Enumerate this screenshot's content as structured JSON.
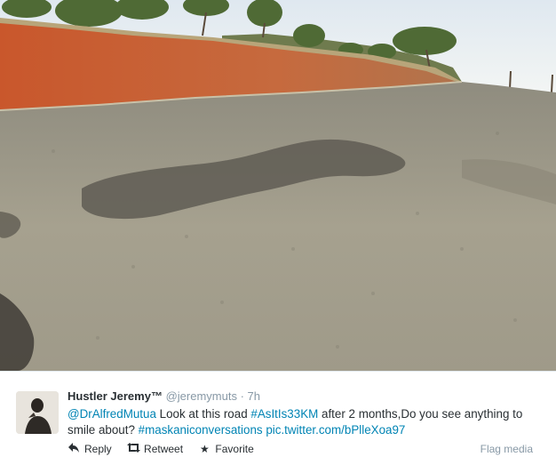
{
  "tweet": {
    "fullname": "Hustler Jeremy™",
    "username": "@jeremymuts",
    "separator": "·",
    "time": "7h",
    "text_segments": [
      {
        "text": "@DrAlfredMutua",
        "type": "mention"
      },
      {
        "text": " Look at this road ",
        "type": "plain"
      },
      {
        "text": "#AsItIs33KM",
        "type": "hashtag"
      },
      {
        "text": " after 2 months,Do you see anything to smile about? ",
        "type": "plain"
      },
      {
        "text": "#maskaniconversations",
        "type": "hashtag"
      },
      {
        "text": " ",
        "type": "plain"
      },
      {
        "text": "pic.twitter.com/bPlleXoa97",
        "type": "link"
      }
    ],
    "actions": {
      "reply_label": "Reply",
      "retweet_label": "Retweet",
      "favorite_label": "Favorite"
    },
    "flag_media_label": "Flag media"
  },
  "icons": {
    "reply": "reply-arrow-icon",
    "retweet": "retweet-icon",
    "favorite": "star-icon"
  },
  "colors": {
    "link": "#0084b4",
    "name": "#292f33",
    "muted": "#8899a6"
  }
}
